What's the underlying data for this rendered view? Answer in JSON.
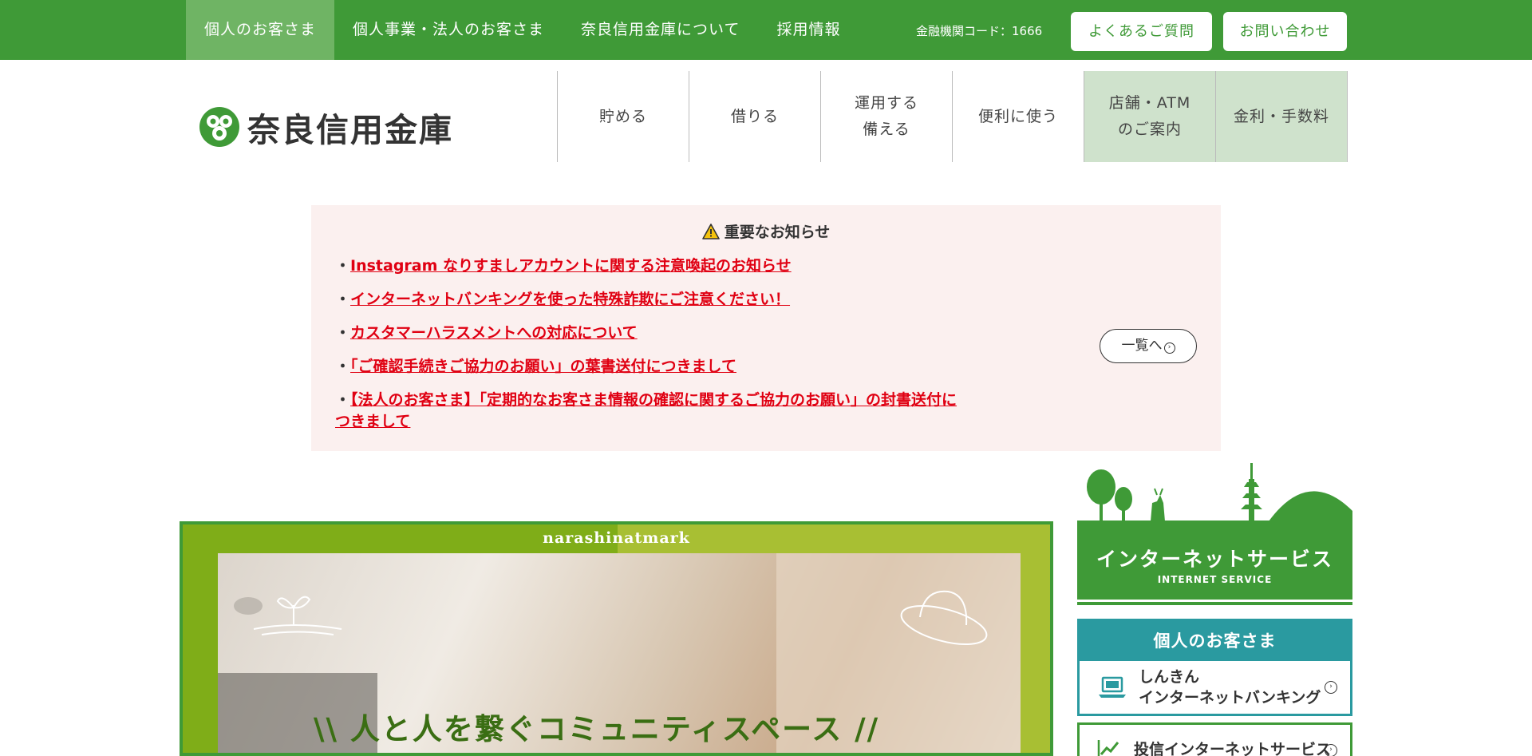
{
  "topnav": {
    "items": [
      {
        "label": "個人のお客さま",
        "active": true
      },
      {
        "label": "個人事業・法人のお客さま",
        "active": false
      },
      {
        "label": "奈良信用金庫について",
        "active": false
      },
      {
        "label": "採用情報",
        "active": false
      }
    ],
    "financial_code": "金融機関コード：1666",
    "faq_label": "よくあるご質問",
    "contact_label": "お問い合わせ"
  },
  "logo": {
    "text": "奈良信用金庫"
  },
  "mainnav": {
    "items": [
      {
        "label": "貯める"
      },
      {
        "label": "借りる"
      },
      {
        "label": "運用する\n備える"
      },
      {
        "label": "便利に使う"
      },
      {
        "label": "店舗・ATM\nのご案内"
      },
      {
        "label": "金利・手数料"
      }
    ]
  },
  "notice": {
    "title": "重要なお知らせ",
    "items": [
      "Instagram なりすましアカウントに関する注意喚起のお知らせ",
      "インターネットバンキングを使った特殊詐欺にご注意ください！",
      "カスタマーハラスメントへの対応について",
      "「ご確認手続きご協力のお願い」の葉書送付につきまして",
      "【法人のお客さま】「定期的なお客さま情報の確認に関するご協力のお願い」の封書送付につきまして"
    ],
    "bullet": "・",
    "more_label": "一覧へ"
  },
  "banner": {
    "brand": "narashinatmark",
    "catch": "\\\\ 人と人を繋ぐコミュニティスペース //"
  },
  "internet_service": {
    "title": "インターネットサービス",
    "title_en": "INTERNET SERVICE",
    "personal": {
      "header": "個人のお客さま",
      "item_label": "しんきん\nインターネットバンキング"
    },
    "invest_label": "投信インターネットサービス"
  },
  "colors": {
    "brand_green": "#3f9a37",
    "notice_bg": "#fbf0ef",
    "notice_link": "#e00012",
    "teal": "#2a9aa0"
  },
  "icons": [
    "warning-icon",
    "logo-mark-icon",
    "arrow-circle-right-icon",
    "laptop-icon",
    "chart-line-icon"
  ]
}
